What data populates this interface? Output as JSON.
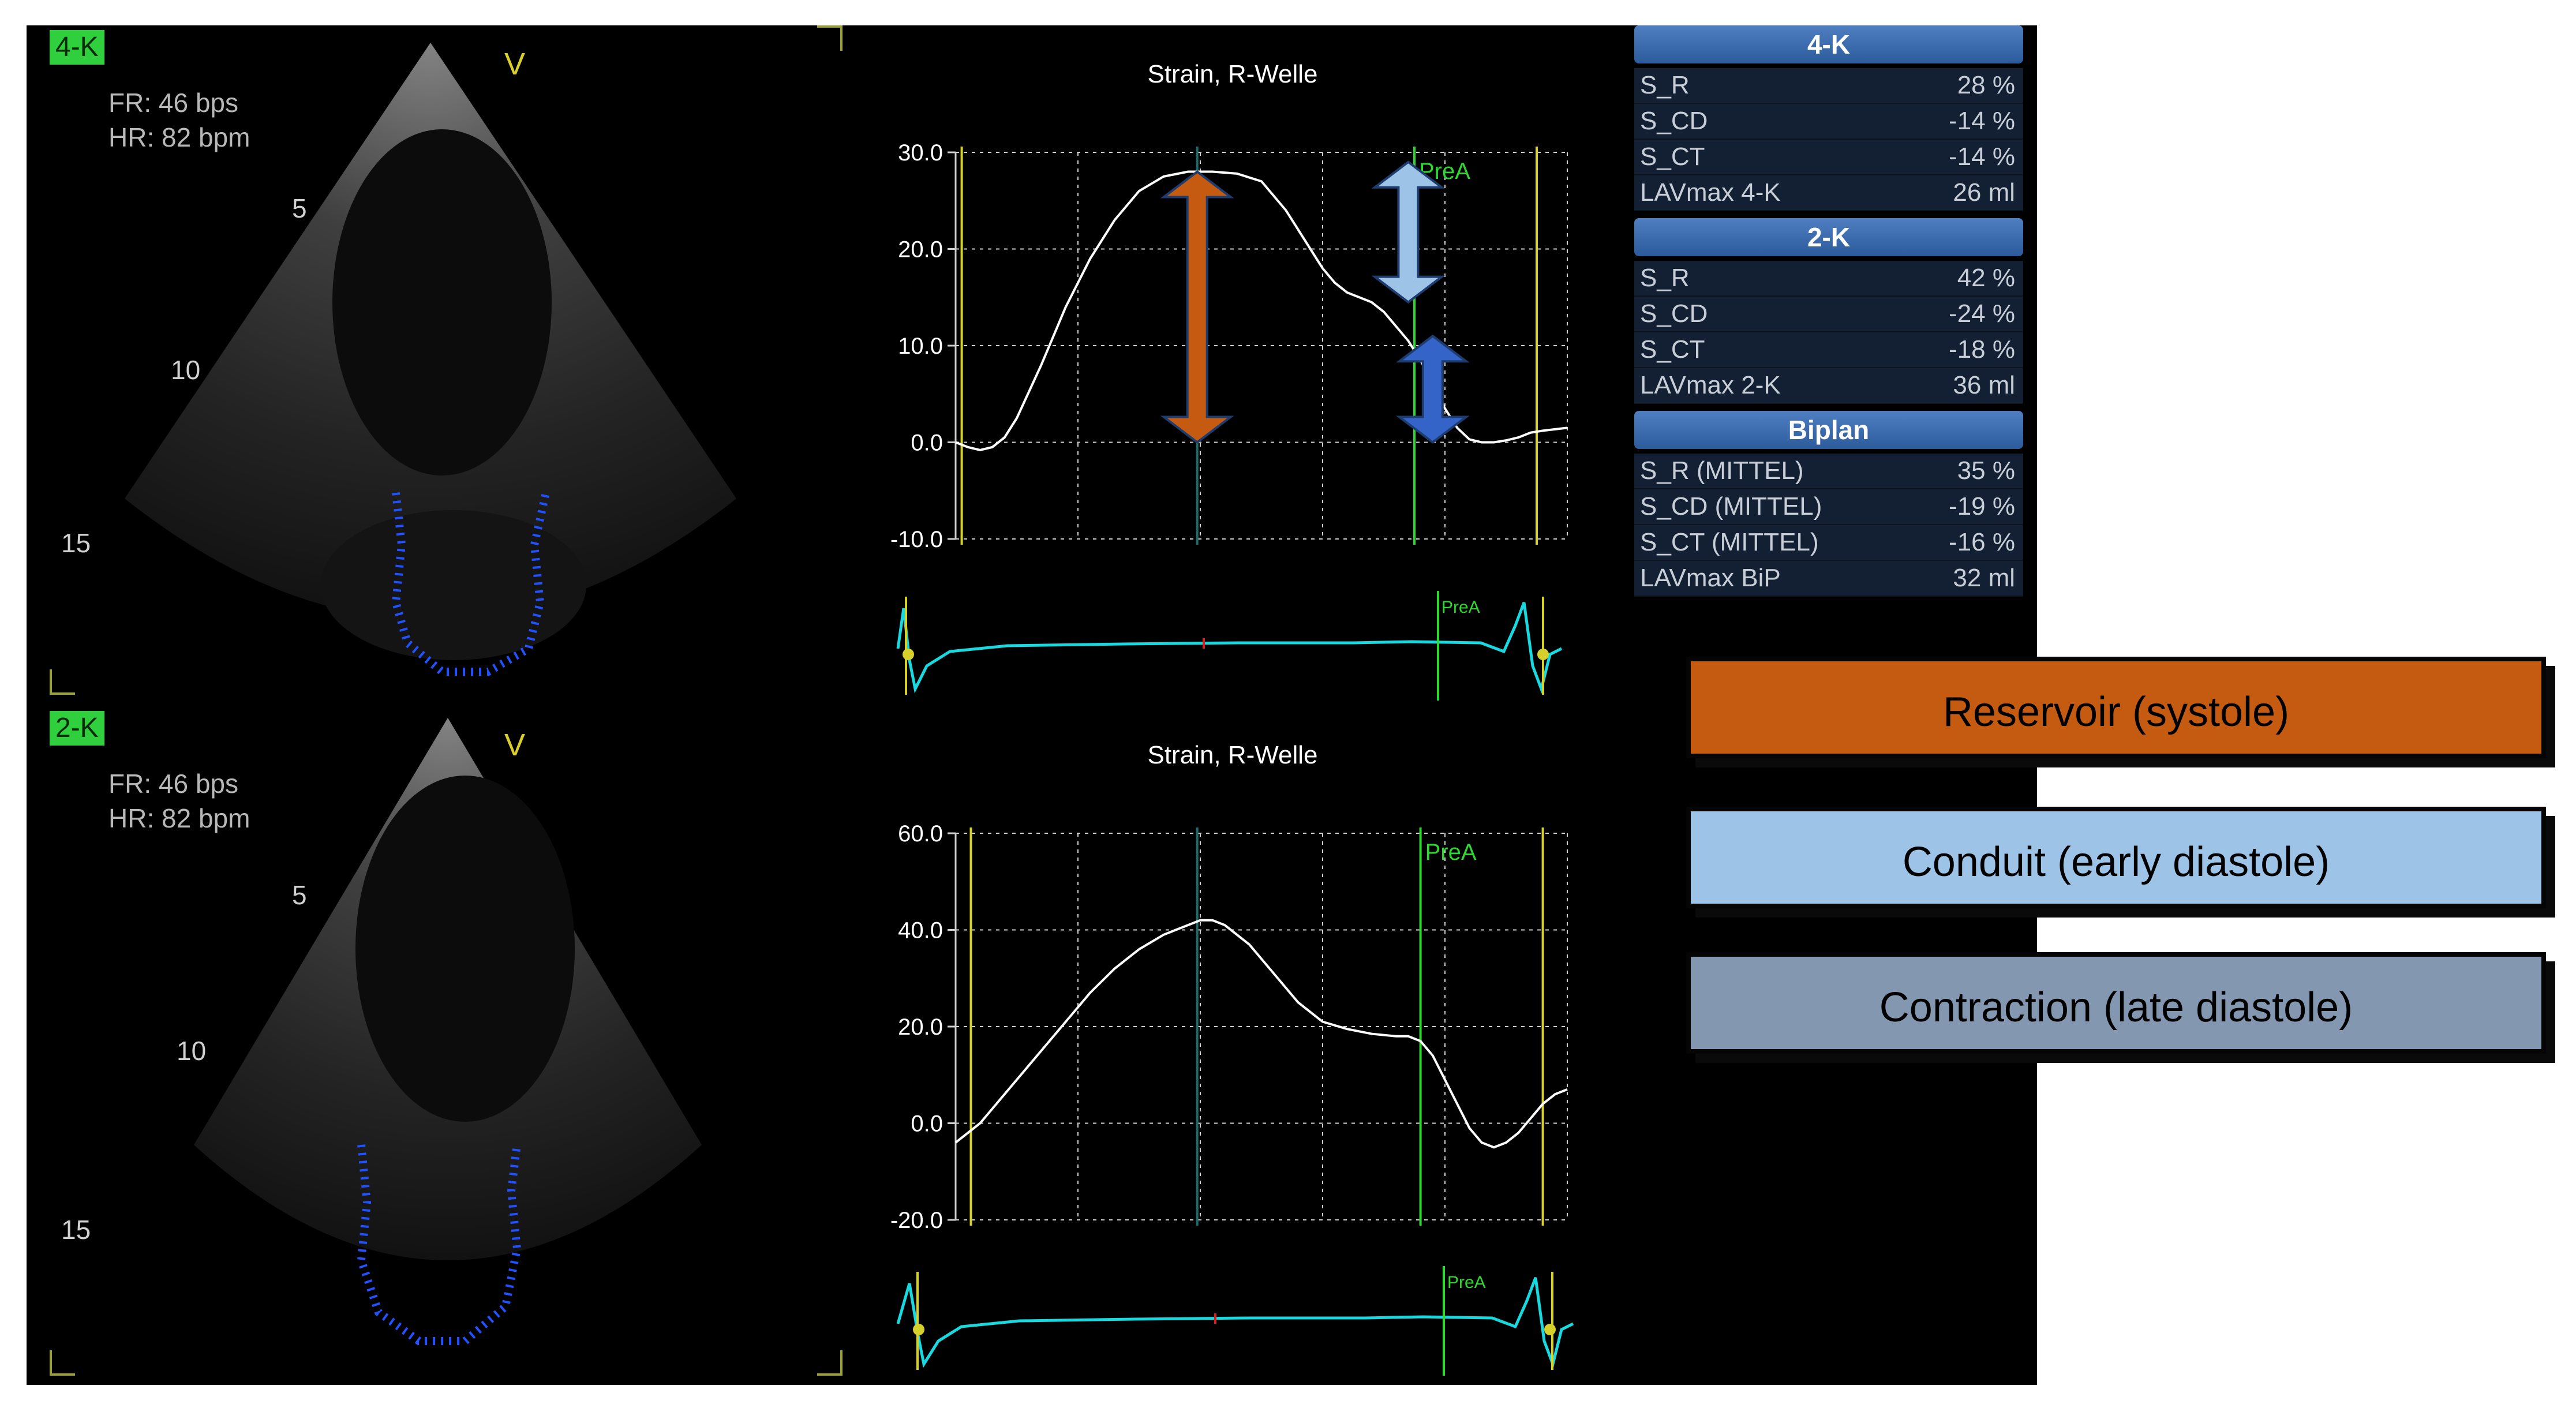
{
  "colors": {
    "reservoir": "#c55a11",
    "conduit": "#9dc3e6",
    "contraction": "#8497b0",
    "strain_curve": "#ffffff",
    "ecg_trace": "#18d8e0",
    "marker_yellow": "#d6d02c",
    "marker_green": "#2fd82f",
    "marker_teal": "#1c6b6b",
    "grid": "#cfcfcf",
    "screen_bg": "#000000",
    "table_header": "#2c5b9c"
  },
  "icons": {
    "reservoir_arrow": "double-headed-arrow-orange",
    "conduit_arrow": "double-headed-arrow-lightblue",
    "contraction_arrow": "double-headed-arrow-blue"
  },
  "echo_views": [
    {
      "badge": "4-K",
      "fr": "FR: 46 bps",
      "hr": "HR: 82 bpm",
      "v_label": "V",
      "depths": [
        "5",
        "10",
        "15"
      ]
    },
    {
      "badge": "2-K",
      "fr": "FR: 46 bps",
      "hr": "HR: 82 bpm",
      "v_label": "V",
      "depths": [
        "5",
        "10",
        "15"
      ]
    }
  ],
  "charts": [
    {
      "title": "Strain, R-Welle",
      "marker_label": "PreA",
      "ecg_marker_label": "PreA"
    },
    {
      "title": "Strain, R-Welle",
      "marker_label": "PreA",
      "ecg_marker_label": "PreA"
    }
  ],
  "chart_data": [
    {
      "type": "line",
      "title": "Strain, R-Welle",
      "ylim": [
        -10,
        30
      ],
      "yticks": [
        "30.0",
        "20.0",
        "10.0",
        "0.0",
        "-10.0"
      ],
      "x": [
        0,
        2,
        4,
        6,
        8,
        10,
        14,
        18,
        22,
        26,
        30,
        34,
        38,
        42,
        46,
        50,
        54,
        56,
        58,
        60,
        62,
        64,
        66,
        68,
        70,
        72,
        74,
        76,
        78,
        80,
        82,
        84,
        86,
        88,
        90,
        92,
        94,
        96,
        100
      ],
      "series": [
        {
          "values": [
            0,
            -0.5,
            -0.8,
            -0.5,
            0.5,
            2.5,
            8,
            14,
            19,
            23,
            26,
            27.5,
            28,
            28,
            27.8,
            27,
            24,
            22,
            20,
            18,
            16.5,
            15.5,
            15,
            14.5,
            13.5,
            12,
            10.5,
            8.5,
            6,
            3.5,
            1.5,
            0.3,
            0,
            0,
            0.2,
            0.5,
            1,
            1.2,
            1.5
          ]
        }
      ],
      "events": [
        {
          "label": "",
          "x": 1
        },
        {
          "label": "",
          "x": 39.5
        },
        {
          "label": "PreA",
          "x": 75
        },
        {
          "label": "",
          "x": 95
        }
      ]
    },
    {
      "type": "line",
      "title": "Strain, R-Welle",
      "ylim": [
        -20,
        60
      ],
      "yticks": [
        "60.0",
        "40.0",
        "20.0",
        "0.0",
        "-20.0"
      ],
      "x": [
        0,
        2,
        4,
        6,
        10,
        14,
        18,
        22,
        26,
        30,
        34,
        38,
        40,
        42,
        44,
        48,
        52,
        56,
        60,
        64,
        68,
        72,
        74,
        76,
        78,
        80,
        82,
        84,
        86,
        88,
        90,
        92,
        94,
        96,
        98,
        100
      ],
      "series": [
        {
          "values": [
            -4,
            -2,
            0,
            3,
            9,
            15,
            21,
            27,
            32,
            36,
            39,
            41,
            42,
            42,
            41,
            37,
            31,
            25,
            21,
            19.5,
            18.5,
            18,
            18,
            17,
            14,
            9,
            4,
            -1,
            -4,
            -5,
            -4,
            -2,
            1,
            4,
            6,
            7
          ]
        }
      ],
      "events": [
        {
          "label": "",
          "x": 2.5
        },
        {
          "label": "",
          "x": 39.5
        },
        {
          "label": "PreA",
          "x": 76
        },
        {
          "label": "",
          "x": 96
        }
      ]
    }
  ],
  "results": {
    "sections": [
      {
        "title": "4-K",
        "rows": [
          {
            "k": "S_R",
            "v": "28 %"
          },
          {
            "k": "S_CD",
            "v": "-14 %"
          },
          {
            "k": "S_CT",
            "v": "-14 %"
          },
          {
            "k": "LAVmax 4-K",
            "v": "26 ml"
          }
        ]
      },
      {
        "title": "2-K",
        "rows": [
          {
            "k": "S_R",
            "v": "42 %"
          },
          {
            "k": "S_CD",
            "v": "-24 %"
          },
          {
            "k": "S_CT",
            "v": "-18 %"
          },
          {
            "k": "LAVmax 2-K",
            "v": "36 ml"
          }
        ]
      },
      {
        "title": "Biplan",
        "rows": [
          {
            "k": "S_R (MITTEL)",
            "v": "35 %"
          },
          {
            "k": "S_CD (MITTEL)",
            "v": "-19 %"
          },
          {
            "k": "S_CT (MITTEL)",
            "v": "-16 %"
          },
          {
            "k": "LAVmax BiP",
            "v": "32 ml"
          }
        ]
      }
    ]
  },
  "legend": {
    "reservoir": "Reservoir (systole)",
    "conduit": "Conduit (early diastole)",
    "contraction": "Contraction (late diastole)"
  }
}
